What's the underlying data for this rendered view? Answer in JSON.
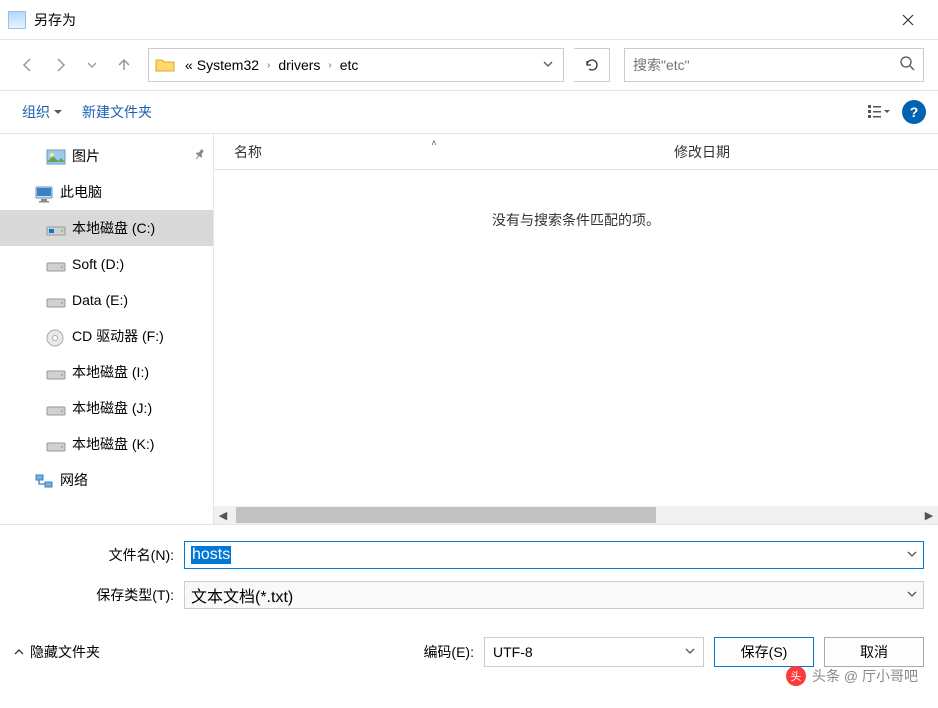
{
  "title": "另存为",
  "breadcrumb": {
    "prefix": "«",
    "parts": [
      "System32",
      "drivers",
      "etc"
    ]
  },
  "search": {
    "placeholder": "搜索\"etc\""
  },
  "toolbar": {
    "organize": "组织",
    "new_folder": "新建文件夹"
  },
  "sidebar": {
    "items": [
      {
        "label": "图片",
        "icon": "picture",
        "root": false,
        "pin": true
      },
      {
        "label": "此电脑",
        "icon": "pc",
        "root": true
      },
      {
        "label": "本地磁盘 (C:)",
        "icon": "drive-win",
        "root": false,
        "selected": true
      },
      {
        "label": "Soft (D:)",
        "icon": "drive",
        "root": false
      },
      {
        "label": "Data (E:)",
        "icon": "drive",
        "root": false
      },
      {
        "label": "CD 驱动器 (F:)",
        "icon": "cd",
        "root": false
      },
      {
        "label": "本地磁盘 (I:)",
        "icon": "drive",
        "root": false
      },
      {
        "label": "本地磁盘 (J:)",
        "icon": "drive",
        "root": false
      },
      {
        "label": "本地磁盘 (K:)",
        "icon": "drive",
        "root": false
      },
      {
        "label": "网络",
        "icon": "network",
        "root": true
      }
    ]
  },
  "columns": {
    "name": "名称",
    "modified": "修改日期"
  },
  "empty_text": "没有与搜索条件匹配的项。",
  "form": {
    "filename_label": "文件名(N):",
    "filename_value": "hosts",
    "filetype_label": "保存类型(T):",
    "filetype_value": "文本文档(*.txt)"
  },
  "footer": {
    "hide_folders": "隐藏文件夹",
    "encoding_label": "编码(E):",
    "encoding_value": "UTF-8",
    "save": "保存(S)",
    "cancel": "取消"
  },
  "watermark": "头条 @ 厅小哥吧"
}
